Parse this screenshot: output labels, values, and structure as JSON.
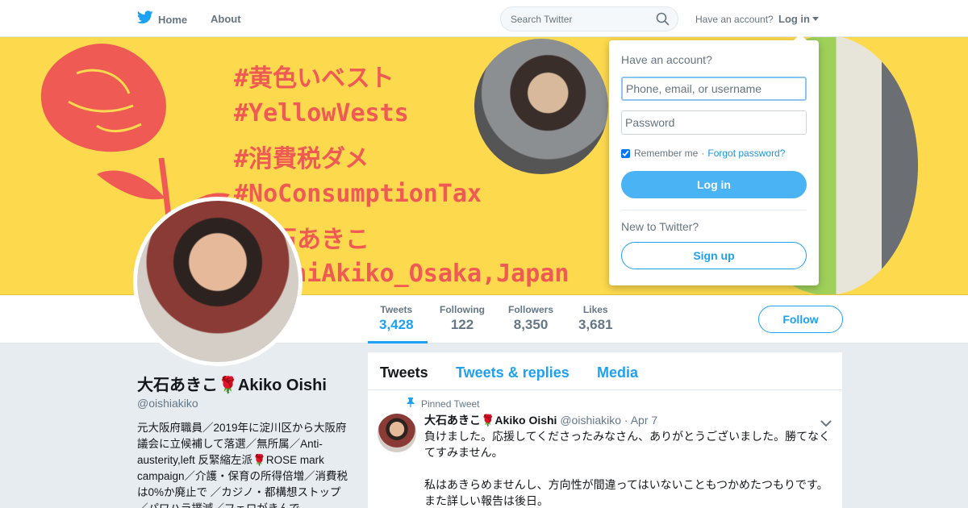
{
  "nav": {
    "home_label": "Home",
    "about_label": "About",
    "search_placeholder": "Search Twitter",
    "have_account": "Have an account?",
    "login_label": "Log in"
  },
  "banner": {
    "lines": [
      "#黄色いベスト",
      "#YellowVests",
      "#消費税ダメ",
      "#NoConsumptionTax",
      "#大石あきこ",
      "#OishiAkiko_Osaka,Japan"
    ]
  },
  "stats": [
    {
      "label": "Tweets",
      "value": "3,428"
    },
    {
      "label": "Following",
      "value": "122"
    },
    {
      "label": "Followers",
      "value": "8,350"
    },
    {
      "label": "Likes",
      "value": "3,681"
    }
  ],
  "follow_label": "Follow",
  "profile": {
    "name": "大石あきこ🌹Akiko Oishi",
    "handle": "@oishiakiko",
    "bio": "元大阪府職員／2019年に淀川区から大阪府議会に立候補して落選／無所属／Anti-austerity,left 反緊縮左派🌹ROSE mark campaign／介護・保育の所得倍増／消費税は0%か廃止で ／カジノ・都構想ストップ／パワハラ撲滅／フェロがきんで"
  },
  "timeline": {
    "tabs": [
      "Tweets",
      "Tweets & replies",
      "Media"
    ],
    "pinned_label": "Pinned Tweet",
    "tweet": {
      "name": "大石あきこ🌹Akiko Oishi",
      "handle": "@oishiakiko",
      "date": "· Apr 7",
      "text1": "負けました。応援してくださったみなさん、ありがとうございました。勝てなくてすみません。",
      "text2": "私はあきらめませんし、方向性が間違ってはいないこともつかめたつもりです。また詳しい報告は後日。"
    }
  },
  "login_dropdown": {
    "title": "Have an account?",
    "username_placeholder": "Phone, email, or username",
    "password_placeholder": "Password",
    "remember_label": "Remember me",
    "separator": "·",
    "forgot_label": "Forgot password?",
    "login_button": "Log in",
    "new_label": "New to Twitter?",
    "signup_button": "Sign up"
  },
  "colors": {
    "accent": "#1da1f2",
    "banner_bg": "#fdd94e",
    "banner_text": "#ef5a55"
  }
}
